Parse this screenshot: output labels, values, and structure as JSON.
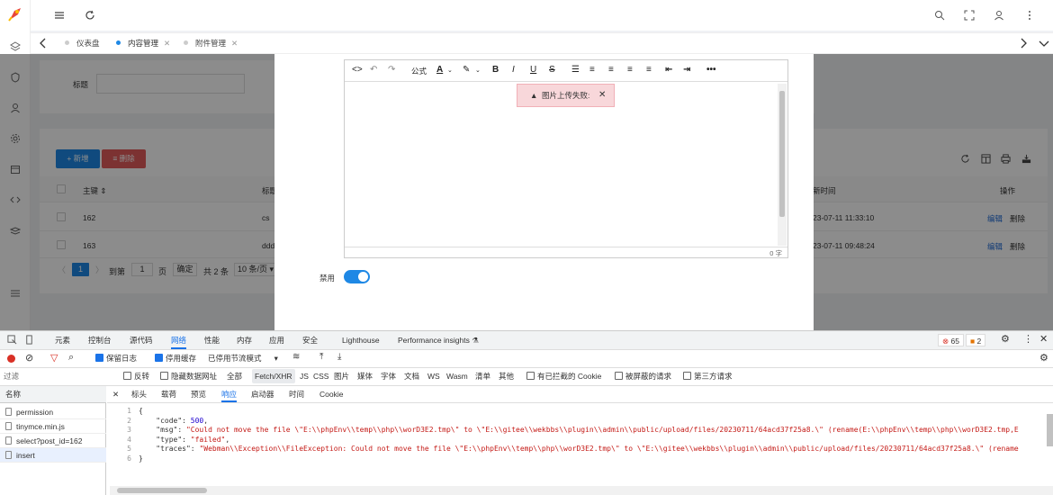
{
  "tabs": [
    {
      "label": "仪表盘"
    },
    {
      "label": "内容管理"
    },
    {
      "label": "附件管理"
    }
  ],
  "search": {
    "title_label": "标题",
    "title_value": ""
  },
  "actions": {
    "add": "+ 新增",
    "delete": "≡ 删除"
  },
  "table": {
    "headers": {
      "id": "主键",
      "title": "标题",
      "time": "新时间",
      "ops": "操作"
    },
    "rows": [
      {
        "id": "162",
        "title": "cs",
        "time": "23-07-11 11:33:10",
        "edit": "编辑",
        "del": "删除"
      },
      {
        "id": "163",
        "title": "ddd",
        "time": "23-07-11 09:48:24",
        "edit": "编辑",
        "del": "删除"
      }
    ]
  },
  "pager": {
    "current": "1",
    "goto": "到第",
    "page_input": "1",
    "page_unit": "页",
    "confirm": "确定",
    "total": "共 2 条",
    "size": "10 条/页"
  },
  "editor": {
    "formula": "公式",
    "wordcount": "0 字",
    "alert": "图片上传失败:"
  },
  "modal": {
    "disable_label": "禁用",
    "disable_on": true
  },
  "devtools": {
    "tabs": [
      "元素",
      "控制台",
      "源代码",
      "网络",
      "性能",
      "内存",
      "应用",
      "安全",
      "Lighthouse",
      "Performance insights"
    ],
    "active_tab": "网络",
    "errors": "65",
    "warnings": "2",
    "toolbar": {
      "preserve": "保留日志",
      "cache": "停用缓存",
      "throttle": "已停用节流模式"
    },
    "filter": {
      "placeholder": "过滤",
      "invert": "反转",
      "hide_data": "隐藏数据网址",
      "types": [
        "全部",
        "Fetch/XHR",
        "JS",
        "CSS",
        "图片",
        "媒体",
        "字体",
        "文档",
        "WS",
        "Wasm",
        "清单",
        "其他"
      ],
      "blocked_cookies": "有已拦截的 Cookie",
      "blocked_requests": "被屏蔽的请求",
      "third_party": "第三方请求"
    },
    "name_header": "名称",
    "requests": [
      "permission",
      "tinymce.min.js",
      "select?post_id=162",
      "insert"
    ],
    "detail_tabs": [
      "标头",
      "载荷",
      "预览",
      "响应",
      "启动器",
      "时间",
      "Cookie"
    ],
    "active_detail": "响应",
    "response": {
      "l1": "{",
      "code_key": "    \"code\": ",
      "code_val": "500",
      "msg_key": "    \"msg\": ",
      "msg_val": "\"Could not move the file \\\"E:\\\\phpEnv\\\\temp\\\\php\\\\worD3E2.tmp\\\" to \\\"E:\\\\gitee\\\\wekbbs\\\\plugin\\\\admin\\\\public/upload/files/20230711/64acd37f25a8.\\\" (rename(E:\\\\phpEnv\\\\temp\\\\php\\\\worD3E2.tmp,E",
      "type_key": "    \"type\": ",
      "type_val": "\"failed\"",
      "traces_key": "    \"traces\": ",
      "traces_val": "\"Webman\\\\Exception\\\\FileException: Could not move the file \\\"E:\\\\phpEnv\\\\temp\\\\php\\\\worD3E2.tmp\\\" to \\\"E:\\\\gitee\\\\wekbbs\\\\plugin\\\\admin\\\\public/upload/files/20230711/64acd37f25a8.\\\" (rename",
      "l6": "}"
    }
  },
  "colors": {
    "primary": "#1e88e5",
    "danger": "#e25c5c",
    "alert_bg": "#f8d7da"
  }
}
